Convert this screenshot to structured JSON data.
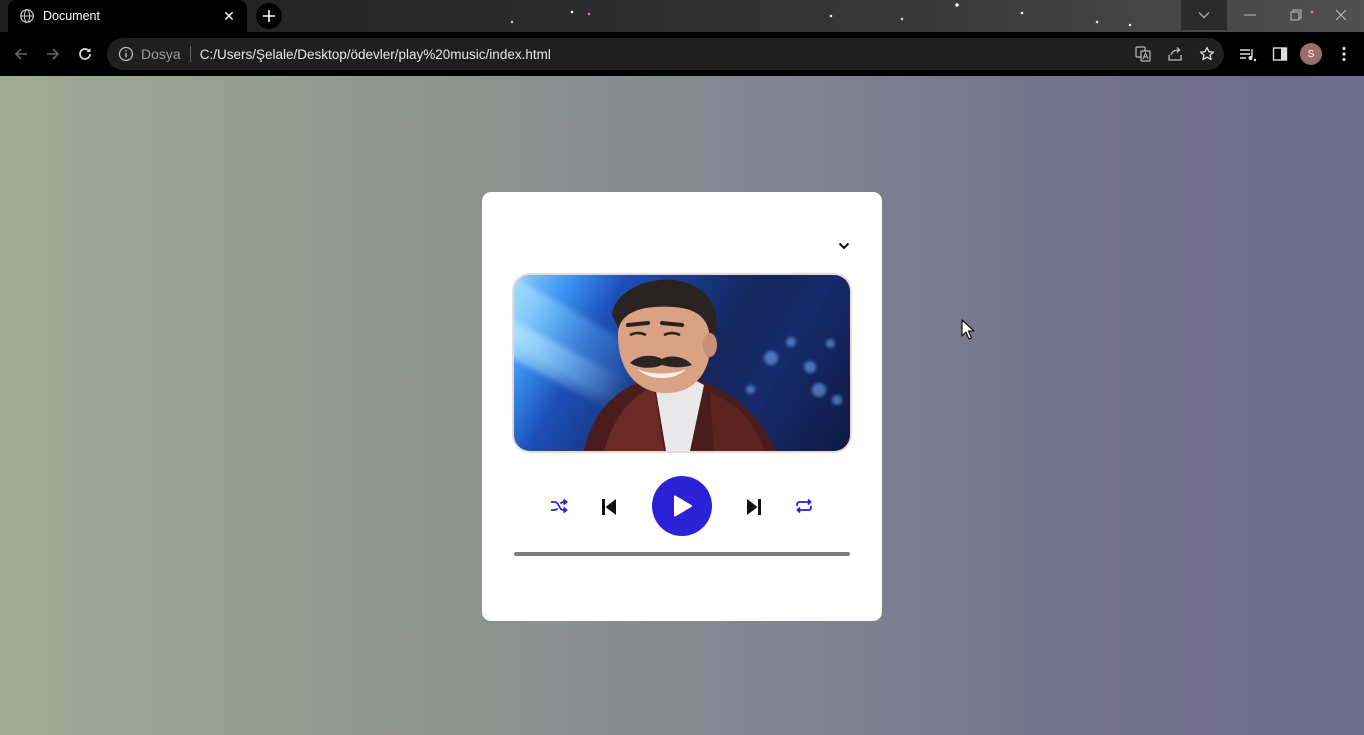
{
  "browser": {
    "tab": {
      "title": "Document",
      "favicon": "globe-icon"
    },
    "address_bar": {
      "site_label": "Dosya",
      "url": "C:/Users/Şelale/Desktop/ödevler/play%20music/index.html"
    },
    "profile_initial": "S",
    "accent": "#9a6e6b"
  },
  "player": {
    "menu_icon": "chevron-down-icon",
    "controls": [
      "shuffle-icon",
      "previous-icon",
      "play-icon",
      "next-icon",
      "repeat-icon"
    ],
    "play_color": "#2b21d6",
    "progress": 0
  }
}
